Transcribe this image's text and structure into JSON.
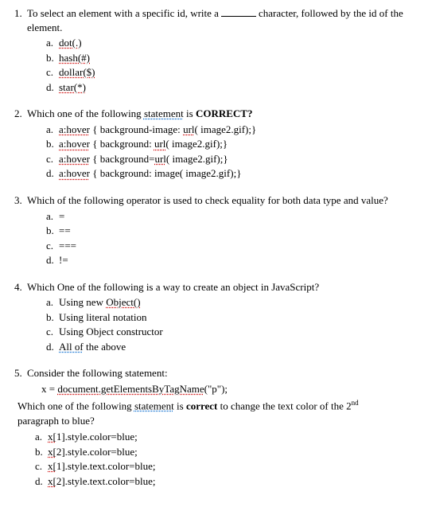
{
  "q1": {
    "num": "1.",
    "text_before": "To select an element with a specific id, write a",
    "text_after": "character, followed by the id of the element.",
    "a_lbl": "a.",
    "a": "dot(.)",
    "b_lbl": "b.",
    "b": "hash(#)",
    "c_lbl": "c.",
    "c": "dollar($)",
    "d_lbl": "d.",
    "d": "star(*)"
  },
  "q2": {
    "num": "2.",
    "text_before": "Which one of the following ",
    "stmt": "statement",
    "text_after": " is ",
    "correct": "CORRECT?",
    "a_lbl": "a.",
    "a_u1": "a:hover",
    "a_mid": " { background-image: ",
    "a_u2": "url",
    "a_end": "( image2.gif);}",
    "b_lbl": "b.",
    "b_u1": "a:hover",
    "b_mid": " { background: ",
    "b_u2": "url",
    "b_end": "( image2.gif);}",
    "c_lbl": "c.",
    "c_u1": "a:hover",
    "c_mid": " { background=",
    "c_u2": "url",
    "c_end": "( image2.gif);}",
    "d_lbl": "d.",
    "d_u1": "a:hover",
    "d_end": " { background: image( image2.gif);}"
  },
  "q3": {
    "num": "3.",
    "text": "Which of the following operator is used to check equality for both data type and value?",
    "a_lbl": "a.",
    "a": "=",
    "b_lbl": "b.",
    "b": "==",
    "c_lbl": "c.",
    "c": "===",
    "d_lbl": "d.",
    "d": "!="
  },
  "q4": {
    "num": "4.",
    "text": "Which One of the following is a way to create an object in JavaScript?",
    "a_lbl": "a.",
    "a_pre": "Using new ",
    "a_u": "Object()",
    "b_lbl": "b.",
    "b": "Using literal notation",
    "c_lbl": "c.",
    "c": "Using Object constructor",
    "d_lbl": "d.",
    "d_pre": "",
    "d_u": "All of",
    "d_post": " the above"
  },
  "q5": {
    "num": "5.",
    "text": "Consider the following statement:",
    "code_pre": "x = ",
    "code_u": "document.getElementsByTagName",
    "code_post": "(\"p\");",
    "line2_pre": "Which one of the following ",
    "line2_u": "statement",
    "line2_mid": " is ",
    "line2_b": "correct",
    "line2_post": " to change the text color of the 2",
    "line2_sup": "nd",
    "line3": "paragraph to blue?",
    "a_lbl": "a.",
    "a_u": "x[",
    "a_post": "1].style.color=blue;",
    "b_lbl": "b.",
    "b_u": "x[",
    "b_post": "2].style.color=blue;",
    "c_lbl": "c.",
    "c_u": "x[",
    "c_post": "1].style.text.color=blue;",
    "d_lbl": "d.",
    "d_u": "x[",
    "d_post": "2].style.text.color=blue;"
  }
}
